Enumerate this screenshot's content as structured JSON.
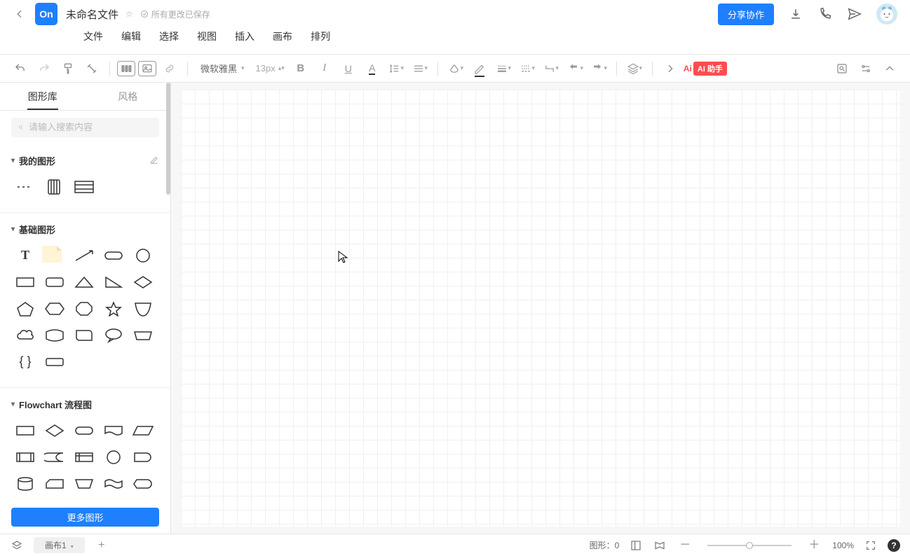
{
  "header": {
    "logo_text": "On",
    "doc_title": "未命名文件",
    "saved_status": "所有更改已保存",
    "share_label": "分享协作",
    "menus": [
      "文件",
      "编辑",
      "选择",
      "视图",
      "插入",
      "画布",
      "排列"
    ]
  },
  "toolbar": {
    "font_family": "微软雅黑",
    "font_size": "13px",
    "ai_prefix": "Ai",
    "ai_label": "AI 助手"
  },
  "sidebar": {
    "tabs": {
      "shapes": "图形库",
      "style": "风格"
    },
    "search_placeholder": "请输入搜索内容",
    "sections": {
      "my_shapes": "我的图形",
      "basic_shapes": "基础图形",
      "flowchart": "Flowchart 流程图"
    },
    "more_shapes_label": "更多图形"
  },
  "statusbar": {
    "page_tab": "画布1",
    "shape_count_label": "图形：",
    "shape_count": "0",
    "zoom": "100%"
  }
}
